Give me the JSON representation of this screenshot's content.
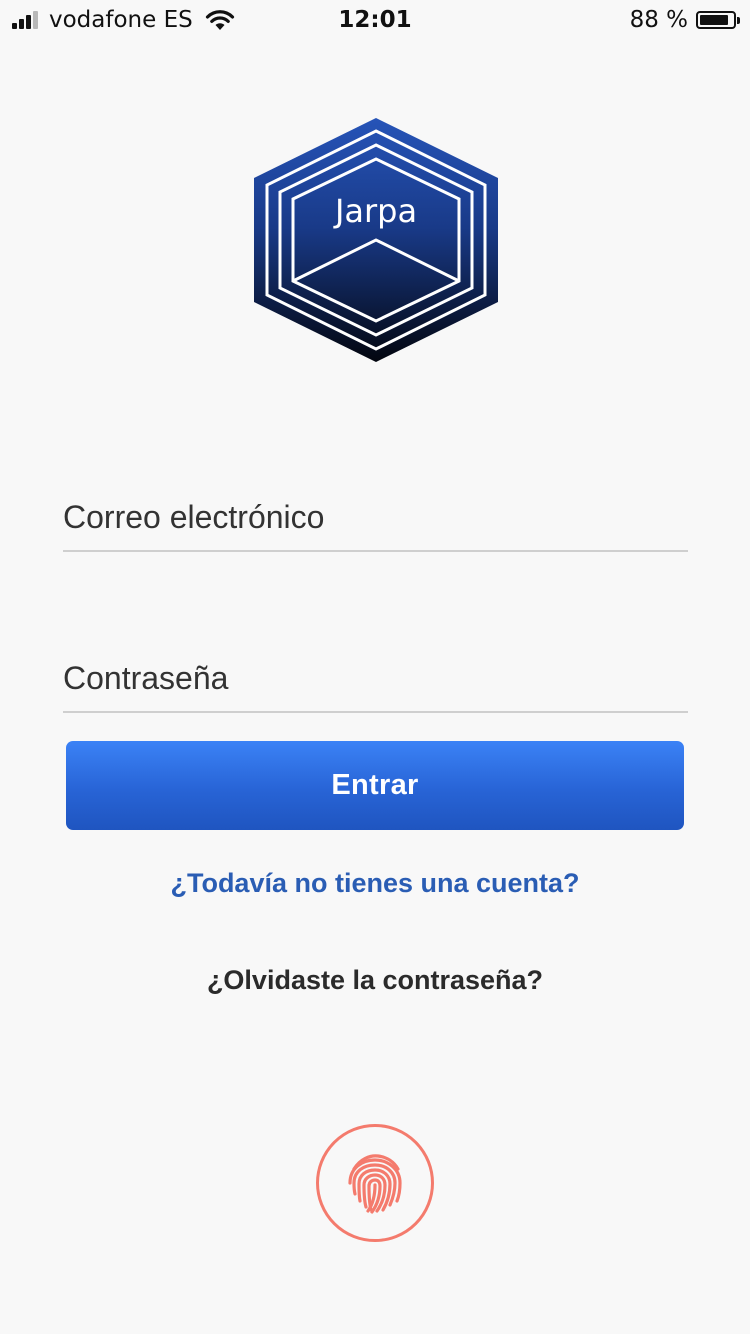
{
  "status_bar": {
    "carrier": "vodafone ES",
    "time": "12:01",
    "battery_text": "88 %",
    "battery_level": 0.88,
    "signal_bars_filled": 3,
    "signal_bars_total": 4
  },
  "logo": {
    "text": "Jarpa"
  },
  "login_form": {
    "email_placeholder": "Correo electrónico",
    "password_placeholder": "Contraseña",
    "submit_label": "Entrar"
  },
  "links": {
    "signup": "¿Todavía no tienes una cuenta?",
    "forgot_password": "¿Olvidaste la contraseña?"
  },
  "icons": {
    "fingerprint": "fingerprint-icon",
    "wifi": "wifi-icon",
    "battery": "battery-icon",
    "signal": "signal-icon"
  },
  "colors": {
    "primary": "#2c6be0",
    "link": "#2a5db4",
    "fingerprint": "#f47b6d",
    "background": "#f8f8f8"
  }
}
